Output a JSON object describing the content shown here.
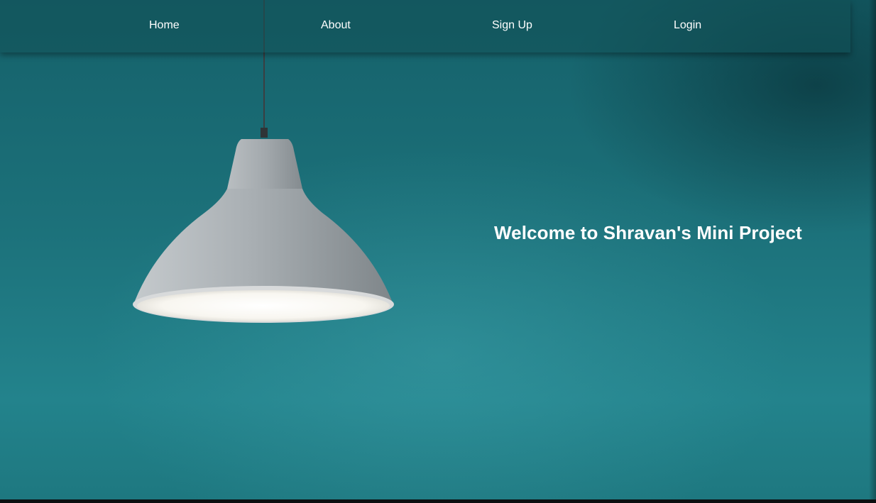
{
  "nav": {
    "items": [
      {
        "label": "Home"
      },
      {
        "label": "About"
      },
      {
        "label": "Sign Up"
      },
      {
        "label": "Login"
      }
    ]
  },
  "hero": {
    "headline": "Welcome to Shravan's Mini Project",
    "background_image": "pendant-lamp-on-teal-wall"
  },
  "colors": {
    "wall": "#1c717a",
    "nav_text": "#ffffff",
    "headline_text": "#ffffff",
    "lamp_shade": "#a7adb1",
    "lamp_light": "#fbfaf6"
  }
}
